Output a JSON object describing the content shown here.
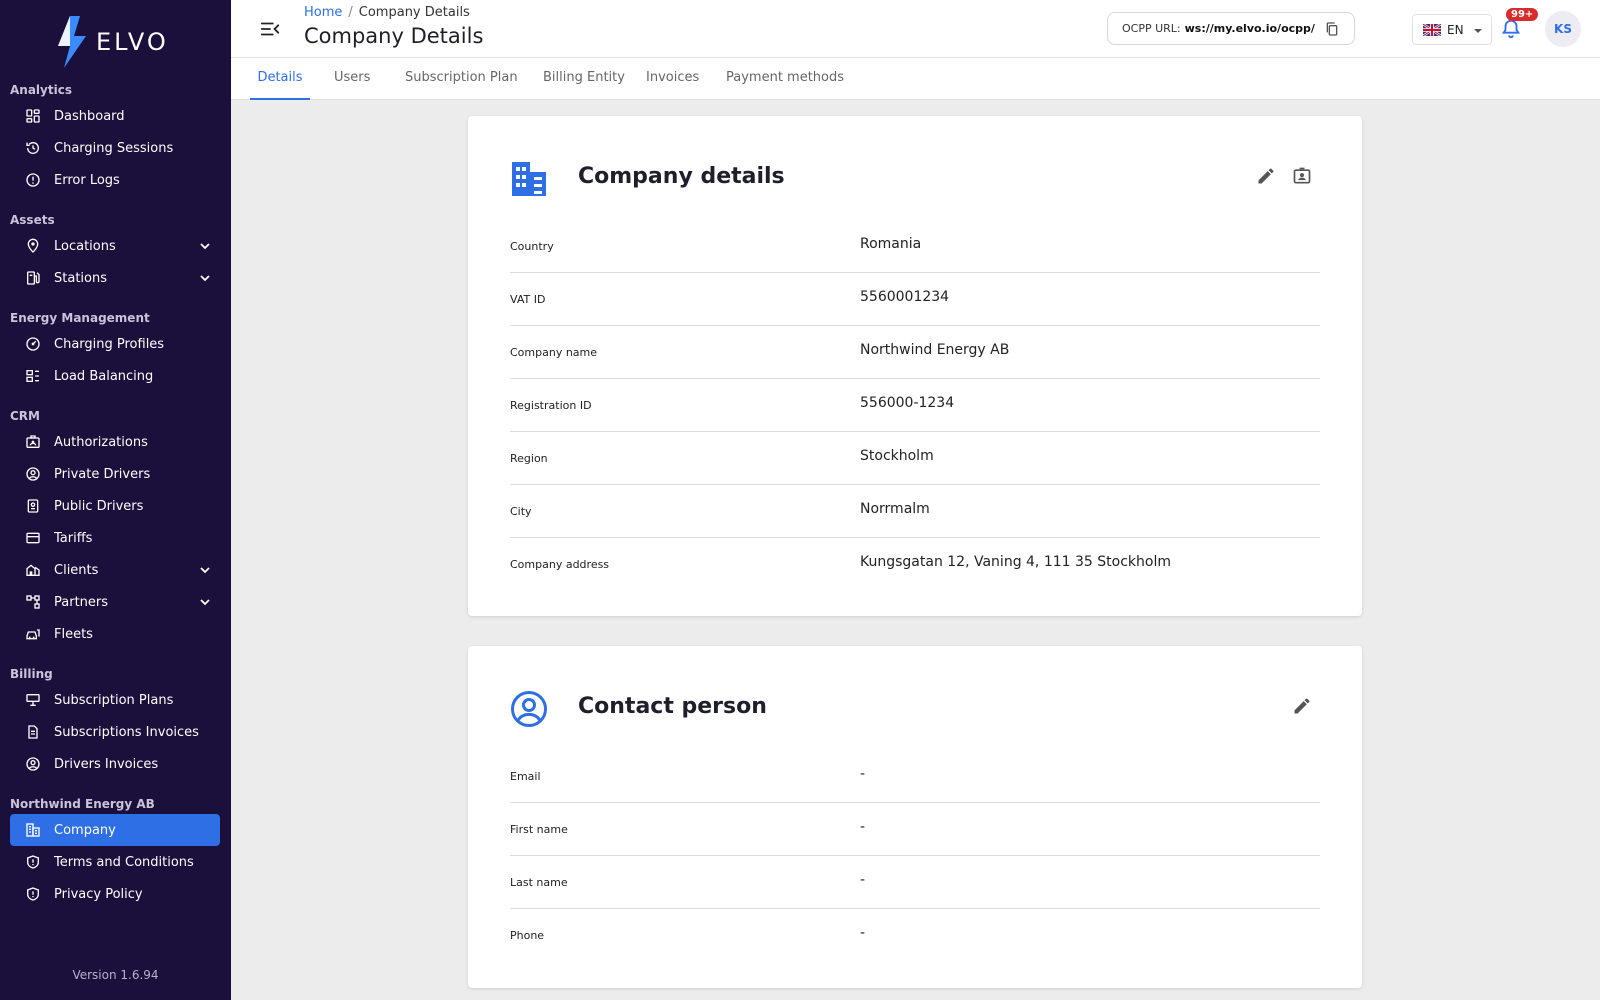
{
  "brand": {
    "name": "ELVO",
    "version": "Version 1.6.94"
  },
  "sidebar": {
    "sections": [
      {
        "title": "Analytics",
        "items": [
          {
            "label": "Dashboard",
            "icon": "dashboard-icon"
          },
          {
            "label": "Charging Sessions",
            "icon": "history-icon"
          },
          {
            "label": "Error Logs",
            "icon": "alert-circle-icon"
          }
        ]
      },
      {
        "title": "Assets",
        "items": [
          {
            "label": "Locations",
            "icon": "location-pin-icon",
            "expandable": true
          },
          {
            "label": "Stations",
            "icon": "station-icon",
            "expandable": true
          }
        ]
      },
      {
        "title": "Energy Management",
        "items": [
          {
            "label": "Charging Profiles",
            "icon": "gauge-icon"
          },
          {
            "label": "Load Balancing",
            "icon": "load-balance-icon"
          }
        ]
      },
      {
        "title": "CRM",
        "items": [
          {
            "label": "Authorizations",
            "icon": "id-card-icon"
          },
          {
            "label": "Private Drivers",
            "icon": "user-circle-icon"
          },
          {
            "label": "Public Drivers",
            "icon": "badge-icon"
          },
          {
            "label": "Tariffs",
            "icon": "credit-card-icon"
          },
          {
            "label": "Clients",
            "icon": "client-house-icon",
            "expandable": true
          },
          {
            "label": "Partners",
            "icon": "partners-icon",
            "expandable": true
          },
          {
            "label": "Fleets",
            "icon": "fleet-icon"
          }
        ]
      },
      {
        "title": "Billing",
        "items": [
          {
            "label": "Subscription Plans",
            "icon": "plans-icon"
          },
          {
            "label": "Subscriptions Invoices",
            "icon": "document-icon"
          },
          {
            "label": "Drivers Invoices",
            "icon": "user-circle-icon"
          }
        ]
      },
      {
        "title": "Northwind Energy AB",
        "items": [
          {
            "label": "Company",
            "icon": "building-icon",
            "active": true
          },
          {
            "label": "Terms and Conditions",
            "icon": "shield-icon"
          },
          {
            "label": "Privacy Policy",
            "icon": "shield-icon"
          }
        ]
      }
    ]
  },
  "header": {
    "breadcrumb_home": "Home",
    "breadcrumb_sep": "/",
    "breadcrumb_current": "Company Details",
    "title": "Company Details",
    "ocpp_label": "OCPP URL:",
    "ocpp_value": "ws://my.elvo.io/ocpp/",
    "lang": "EN",
    "notifications": "99+",
    "avatar": "KS"
  },
  "tabs": [
    "Details",
    "Users",
    "Subscription Plan",
    "Billing Entity",
    "Invoices",
    "Payment methods"
  ],
  "company_card": {
    "title": "Company details",
    "rows": [
      {
        "label": "Country",
        "value": "Romania"
      },
      {
        "label": "VAT ID",
        "value": "5560001234"
      },
      {
        "label": "Company name",
        "value": "Northwind Energy AB"
      },
      {
        "label": "Registration ID",
        "value": "556000-1234"
      },
      {
        "label": "Region",
        "value": "Stockholm"
      },
      {
        "label": "City",
        "value": "Norrmalm"
      },
      {
        "label": "Company address",
        "value": "Kungsgatan 12, Vaning 4, 111 35 Stockholm"
      }
    ]
  },
  "contact_card": {
    "title": "Contact person",
    "rows": [
      {
        "label": "Email",
        "value": "-"
      },
      {
        "label": "First name",
        "value": "-"
      },
      {
        "label": "Last name",
        "value": "-"
      },
      {
        "label": "Phone",
        "value": "-"
      }
    ]
  },
  "colors": {
    "sidebar": "#1b0f3b",
    "accent": "#2f6fe6",
    "badge": "#d92d2d"
  }
}
